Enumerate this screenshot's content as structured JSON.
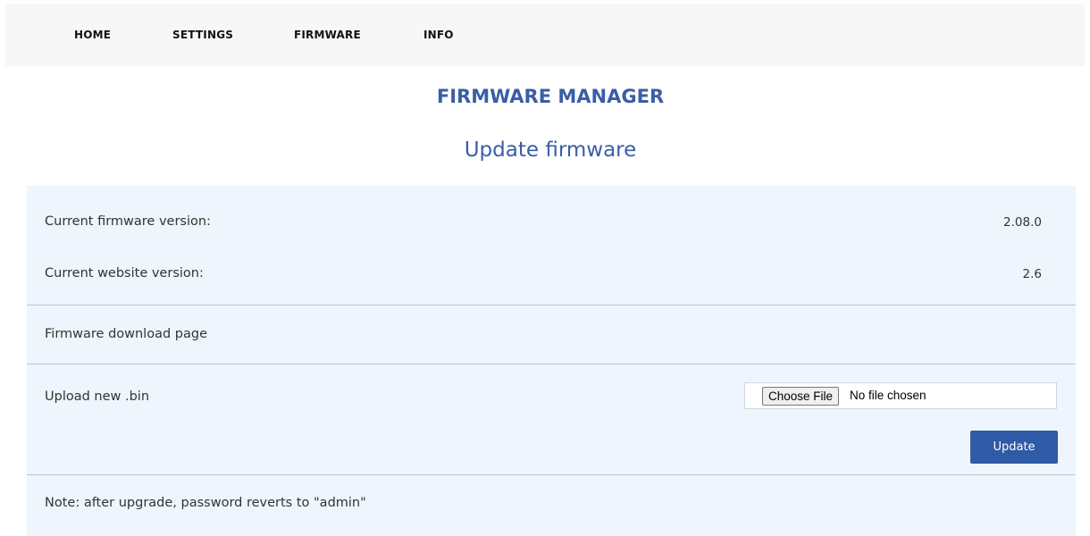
{
  "nav": {
    "items": [
      {
        "label": "HOME"
      },
      {
        "label": "SETTINGS"
      },
      {
        "label": "FIRMWARE"
      },
      {
        "label": "INFO"
      }
    ]
  },
  "page": {
    "title": "FIRMWARE MANAGER",
    "section_title": "Update firmware"
  },
  "versions": {
    "firmware_label": "Current firmware version:",
    "firmware_value": "2.08.0",
    "website_label": "Current website version:",
    "website_value": "2.6"
  },
  "download": {
    "link_label": "Firmware download page"
  },
  "upload": {
    "label": "Upload new .bin",
    "choose_button": "Choose File",
    "file_status": "No file chosen",
    "update_button": "Update"
  },
  "note": {
    "text": "Note: after upgrade, password reverts to \"admin\""
  },
  "colors": {
    "accent": "#3a5ea6",
    "button": "#2f5aa5",
    "panel_bg": "#eef5fd",
    "navbar_bg": "#f7f7f7"
  }
}
